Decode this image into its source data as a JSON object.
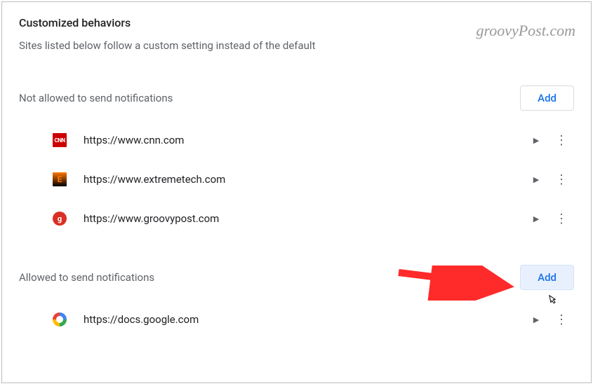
{
  "watermark": "groovyPost.com",
  "header": {
    "title": "Customized behaviors",
    "subtitle": "Sites listed below follow a custom setting instead of the default"
  },
  "sections": {
    "not_allowed": {
      "label": "Not allowed to send notifications",
      "add_label": "Add",
      "items": [
        {
          "favicon_text": "CNN",
          "favicon_class": "favicon-cnn",
          "url": "https://www.cnn.com"
        },
        {
          "favicon_text": "E",
          "favicon_class": "favicon-et",
          "url": "https://www.extremetech.com"
        },
        {
          "favicon_text": "g",
          "favicon_class": "favicon-gp",
          "url": "https://www.groovypost.com"
        }
      ]
    },
    "allowed": {
      "label": "Allowed to send notifications",
      "add_label": "Add",
      "items": [
        {
          "favicon_text": "",
          "favicon_class": "favicon-gd",
          "url": "https://docs.google.com"
        }
      ]
    }
  }
}
